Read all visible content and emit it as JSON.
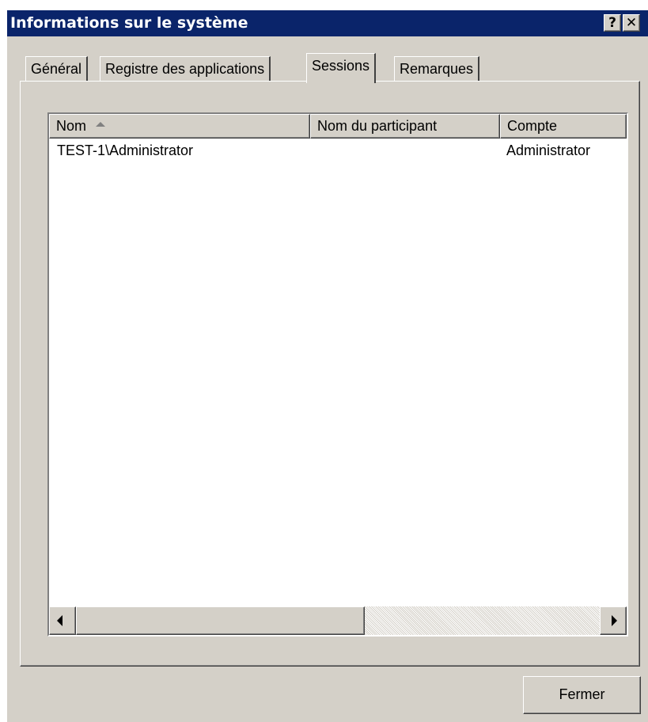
{
  "window": {
    "title": "Informations sur le système",
    "help_label": "?",
    "close_label": "✕"
  },
  "tabs": [
    {
      "label": "Général",
      "active": false
    },
    {
      "label": "Registre des applications",
      "active": false
    },
    {
      "label": "Sessions",
      "active": true
    },
    {
      "label": "Remarques",
      "active": false
    }
  ],
  "list": {
    "columns": [
      "Nom",
      "Nom du participant",
      "Compte"
    ],
    "sort_column": "Nom",
    "sort_direction": "ascending",
    "rows": [
      [
        "TEST-1\\Administrator",
        "",
        "Administrator"
      ]
    ]
  },
  "buttons": {
    "close_label": "Fermer"
  },
  "colors": {
    "titlebar": "#0a246a",
    "face": "#d4d0c8"
  }
}
